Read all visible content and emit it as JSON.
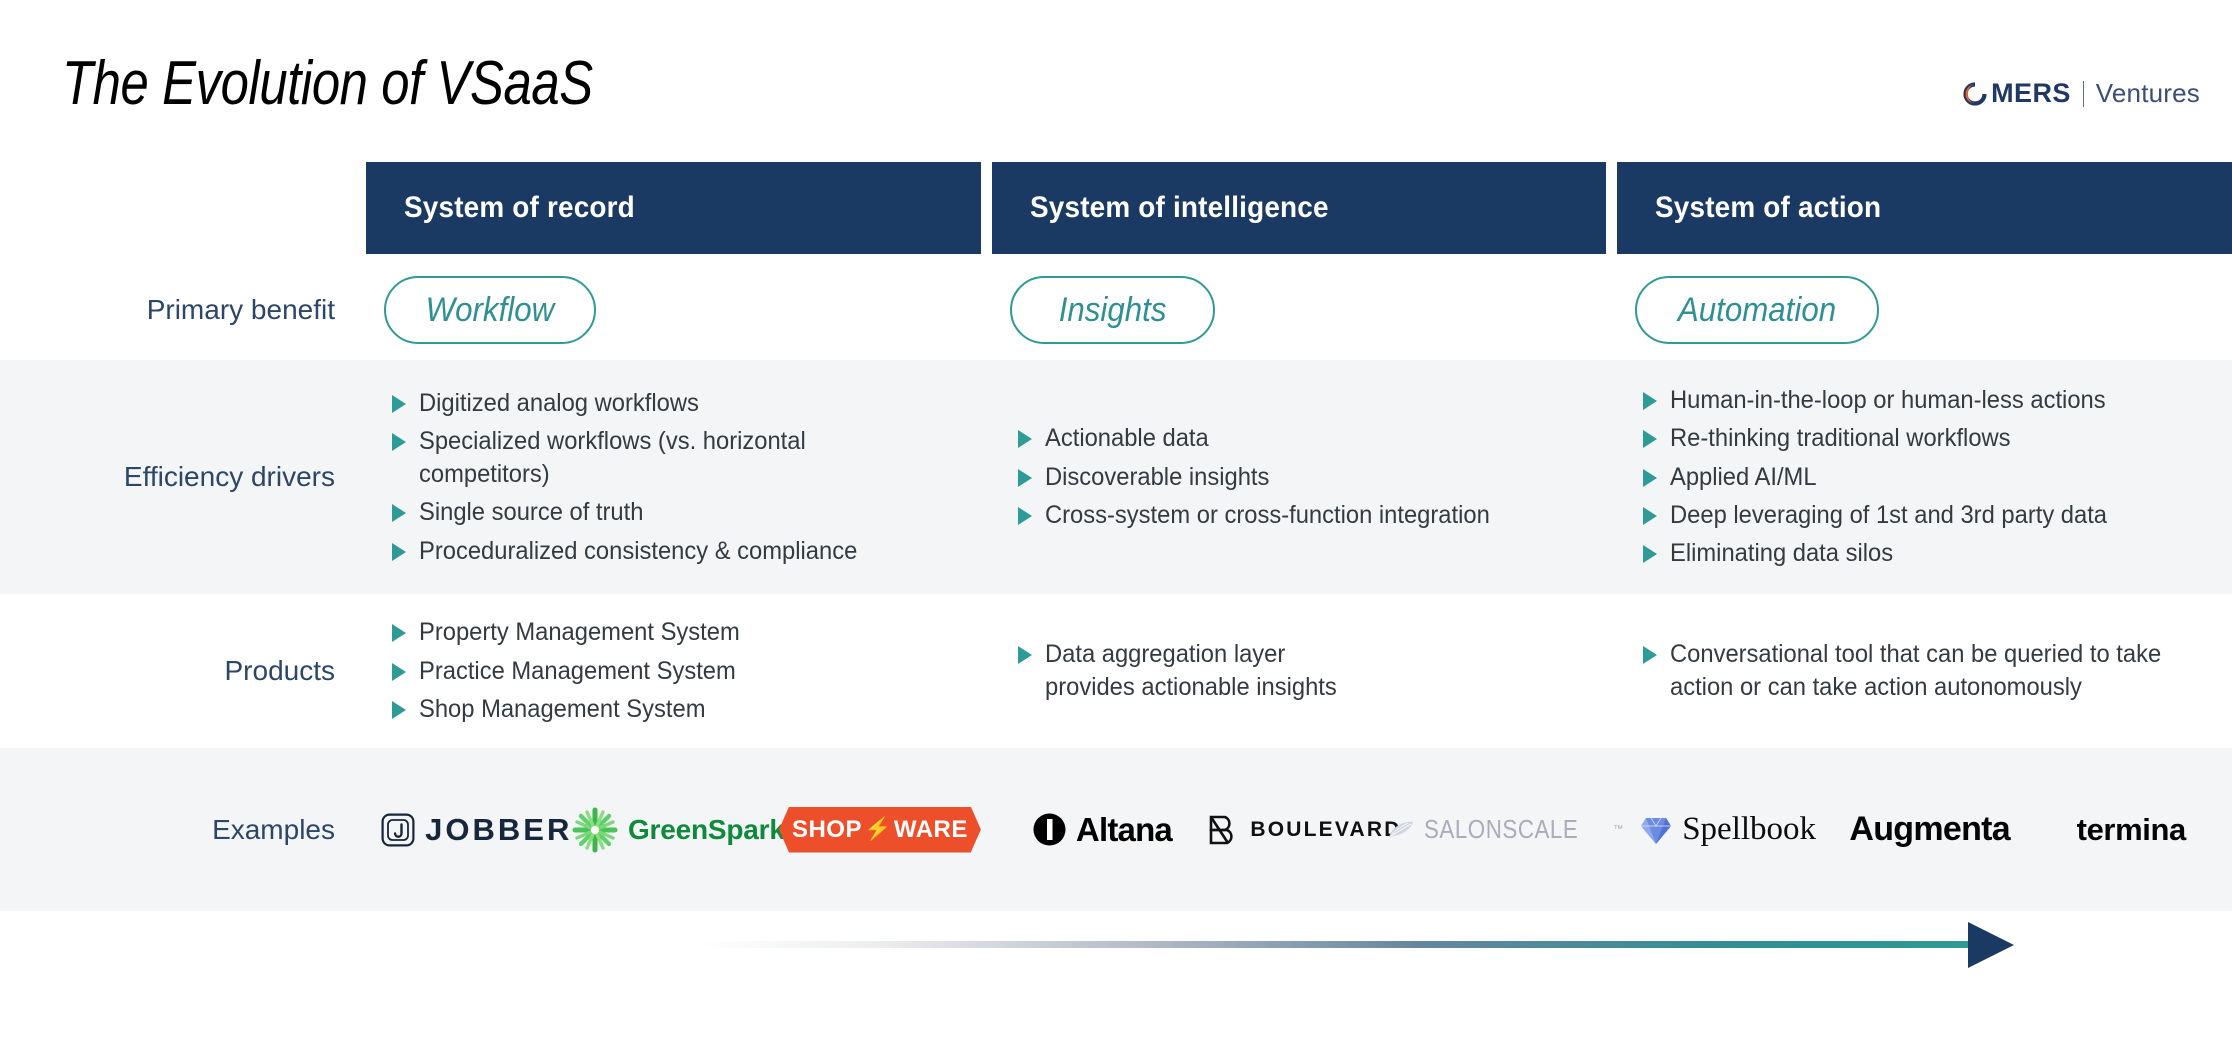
{
  "header": {
    "title": "The Evolution of VSaaS",
    "logo": {
      "mark_letter": "O",
      "name": "MERS",
      "divider": "|",
      "suffix": "Ventures"
    }
  },
  "columns": [
    {
      "title": "System of record"
    },
    {
      "title": "System of intelligence"
    },
    {
      "title": "System of action"
    }
  ],
  "rows": {
    "primary_benefit": {
      "label": "Primary benefit",
      "values": [
        "Workflow",
        "Insights",
        "Automation"
      ]
    },
    "efficiency_drivers": {
      "label": "Efficiency drivers",
      "columns": [
        [
          "Digitized analog workflows",
          "Specialized workflows (vs. horizontal competitors)",
          "Single source of truth",
          "Proceduralized consistency & compliance"
        ],
        [
          "Actionable data",
          "Discoverable insights",
          "Cross-system or cross-function integration"
        ],
        [
          "Human-in-the-loop or human-less actions",
          "Re-thinking traditional workflows",
          "Applied AI/ML",
          "Deep leveraging of 1st and 3rd party data",
          "Eliminating data silos"
        ]
      ]
    },
    "products": {
      "label": "Products",
      "columns": [
        [
          "Property Management System",
          "Practice Management System",
          "Shop Management System"
        ],
        [
          "Data aggregation layer provides actionable insights"
        ],
        [
          "Conversational tool that can be queried to take action or can take action autonomously"
        ]
      ]
    },
    "examples": {
      "label": "Examples",
      "columns": [
        [
          {
            "name": "Jobber",
            "text": "JOBBER"
          },
          {
            "name": "GreenSpark",
            "text": "GreenSpark"
          },
          {
            "name": "Shop-Ware",
            "text_a": "SHOP",
            "bolt": "⚡",
            "text_b": "WARE"
          }
        ],
        [
          {
            "name": "Altana",
            "text": "Altana"
          },
          {
            "name": "Boulevard",
            "text": "BOULEVARD"
          },
          {
            "name": "SalonScale",
            "text": "SALONSCALE",
            "tm": "™"
          }
        ],
        [
          {
            "name": "Spellbook",
            "text": "Spellbook"
          },
          {
            "name": "Augmenta",
            "text": "Augmenta"
          },
          {
            "name": "Termina",
            "text": "termina"
          }
        ]
      ]
    }
  },
  "colors": {
    "navy": "#1b3a63",
    "teal": "#2f9a96",
    "band": "#f3f5f7",
    "label_blue": "#2c4668",
    "omers_orange": "#e8601f",
    "omers_navy": "#1f3864"
  }
}
